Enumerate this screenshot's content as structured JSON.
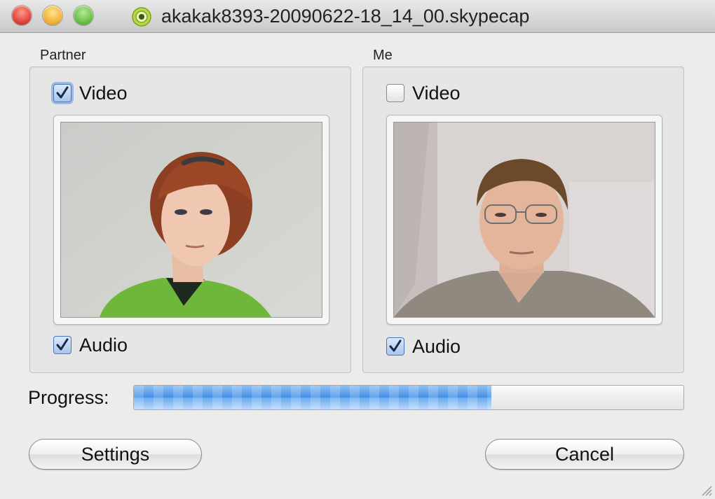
{
  "window": {
    "title": "akakak8393-20090622-18_14_00.skypecap",
    "app_icon": "skype-recorder-icon"
  },
  "partner": {
    "group_label": "Partner",
    "video_label": "Video",
    "video_checked": true,
    "audio_label": "Audio",
    "audio_checked": true
  },
  "me": {
    "group_label": "Me",
    "video_label": "Video",
    "video_checked": false,
    "audio_label": "Audio",
    "audio_checked": true
  },
  "progress": {
    "label": "Progress:",
    "fraction": 0.65
  },
  "buttons": {
    "settings_label": "Settings",
    "cancel_label": "Cancel"
  },
  "colors": {
    "accent_blue": "#3f8fe6",
    "window_bg": "#ececec"
  }
}
